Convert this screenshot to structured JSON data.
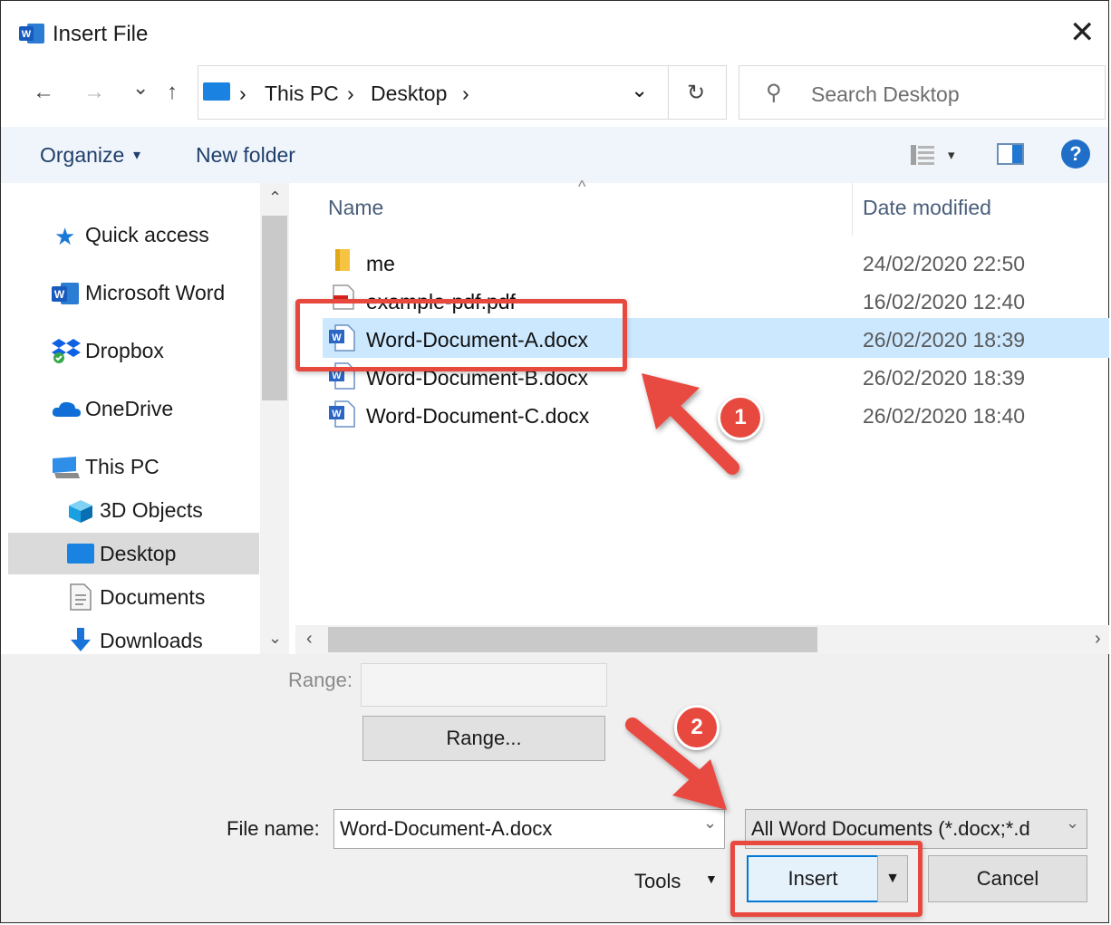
{
  "window": {
    "title": "Insert File",
    "close_label": "✕"
  },
  "nav": {
    "back": "←",
    "forward": "→",
    "recent": "⌄",
    "up": "↑",
    "breadcrumbs": [
      "This PC",
      "Desktop"
    ],
    "crumb_sep": "›",
    "dropdown": "⌄",
    "refresh": "↻",
    "search_placeholder": "Search Desktop",
    "search_icon": "⚲"
  },
  "toolbar": {
    "organize": "Organize",
    "organize_caret": "▾",
    "new_folder": "New folder",
    "view_caret": "▾",
    "help": "?"
  },
  "sidebar": {
    "items": [
      {
        "label": "Quick access",
        "icon": "star-icon"
      },
      {
        "label": "Microsoft Word",
        "icon": "word-icon"
      },
      {
        "label": "Dropbox",
        "icon": "dropbox-icon"
      },
      {
        "label": "OneDrive",
        "icon": "cloud-icon"
      },
      {
        "label": "This PC",
        "icon": "computer-icon"
      },
      {
        "label": "3D Objects",
        "icon": "cube-icon"
      },
      {
        "label": "Desktop",
        "icon": "desktop-icon"
      },
      {
        "label": "Documents",
        "icon": "document-icon"
      },
      {
        "label": "Downloads",
        "icon": "download-icon"
      }
    ],
    "scroll_up": "⌃",
    "scroll_down": "⌄"
  },
  "files": {
    "columns": {
      "name": "Name",
      "date": "Date modified",
      "sort_indicator": "^"
    },
    "rows": [
      {
        "name": "me",
        "date": "24/02/2020 22:50",
        "icon": "folder-icon"
      },
      {
        "name": "example-pdf.pdf",
        "date": "16/02/2020 12:40",
        "icon": "pdf-icon"
      },
      {
        "name": "Word-Document-A.docx",
        "date": "26/02/2020 18:39",
        "icon": "word-doc-icon"
      },
      {
        "name": "Word-Document-B.docx",
        "date": "26/02/2020 18:39",
        "icon": "word-doc-icon"
      },
      {
        "name": "Word-Document-C.docx",
        "date": "26/02/2020 18:40",
        "icon": "word-doc-icon"
      }
    ],
    "selected_index": 2,
    "scroll_left": "‹",
    "scroll_right": "›"
  },
  "bottom": {
    "range_label": "Range:",
    "range_value": "",
    "range_button": "Range...",
    "file_name_label": "File name:",
    "file_name_value": "Word-Document-A.docx",
    "file_type": "All Word Documents (*.docx;*.d",
    "tools": "Tools",
    "tools_caret": "▼",
    "insert": "Insert",
    "insert_caret": "▼",
    "cancel": "Cancel",
    "combo_caret": "⌄"
  },
  "annotations": {
    "step1": "1",
    "step2": "2",
    "color": "#e8493f"
  }
}
